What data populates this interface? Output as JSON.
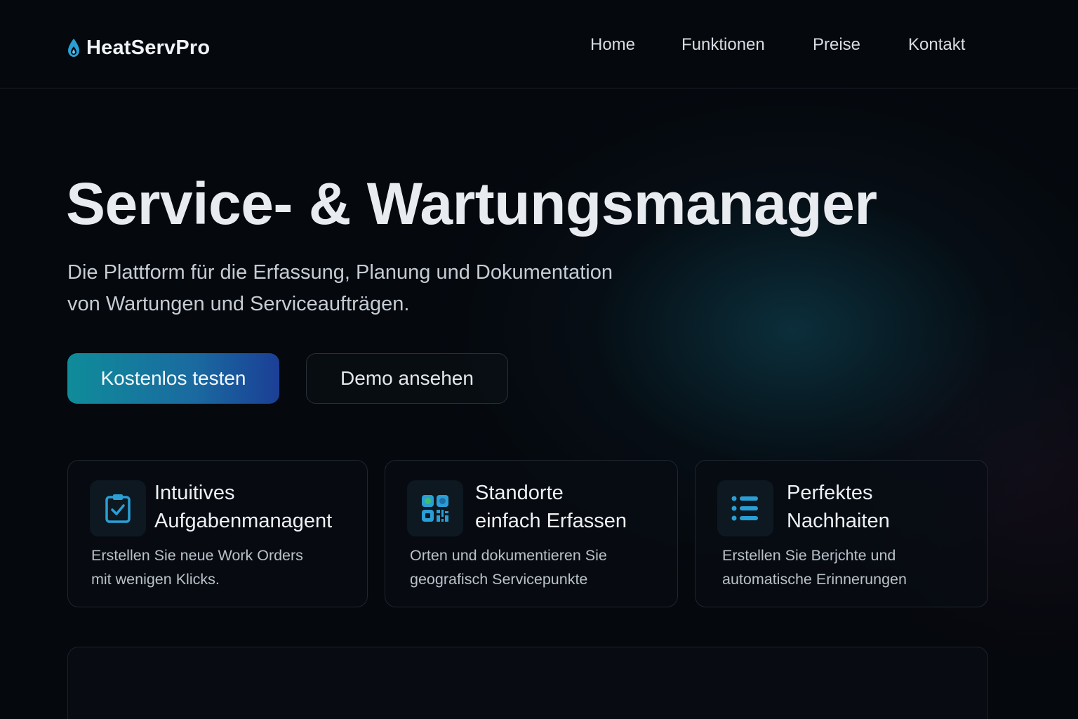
{
  "brand": {
    "name": "HeatServPro",
    "icon": "flame-drop-icon"
  },
  "nav": {
    "items": [
      "Home",
      "Funktionen",
      "Preise",
      "Kontakt"
    ]
  },
  "hero": {
    "title": "Service-  & Wartungsmanager",
    "subtitle_line1": "Die Plattform für die Erfassung, Planung und Dokumentation",
    "subtitle_line2": "von Wartungen und Serviceaufträgen.",
    "primary_button": "Kostenlos testen",
    "secondary_button": "Demo ansehen"
  },
  "features": [
    {
      "icon": "clipboard-check-icon",
      "title_line1": "Intuitives",
      "title_line2": "Aufgabenmanagent",
      "desc_line1": "Erstellen Sie neue Work Orders",
      "desc_line2": "mit wenigen Klicks."
    },
    {
      "icon": "qr-code-icon",
      "title_line1": "Standorte",
      "title_line2": "einfach Erfassen",
      "desc_line1": "Orten und dokumentieren Sie",
      "desc_line2": "geografisch Servicepunkte"
    },
    {
      "icon": "list-icon",
      "title_line1": "Perfektes",
      "title_line2": "Nachhaiten",
      "desc_line1": "Erstellen Sie Berjchte und",
      "desc_line2": "automatische Erinnerungen"
    }
  ],
  "colors": {
    "background": "#05080d",
    "accent_teal": "#0f8c9a",
    "accent_blue": "#1b3f96",
    "icon_blue": "#2a9fd6"
  }
}
